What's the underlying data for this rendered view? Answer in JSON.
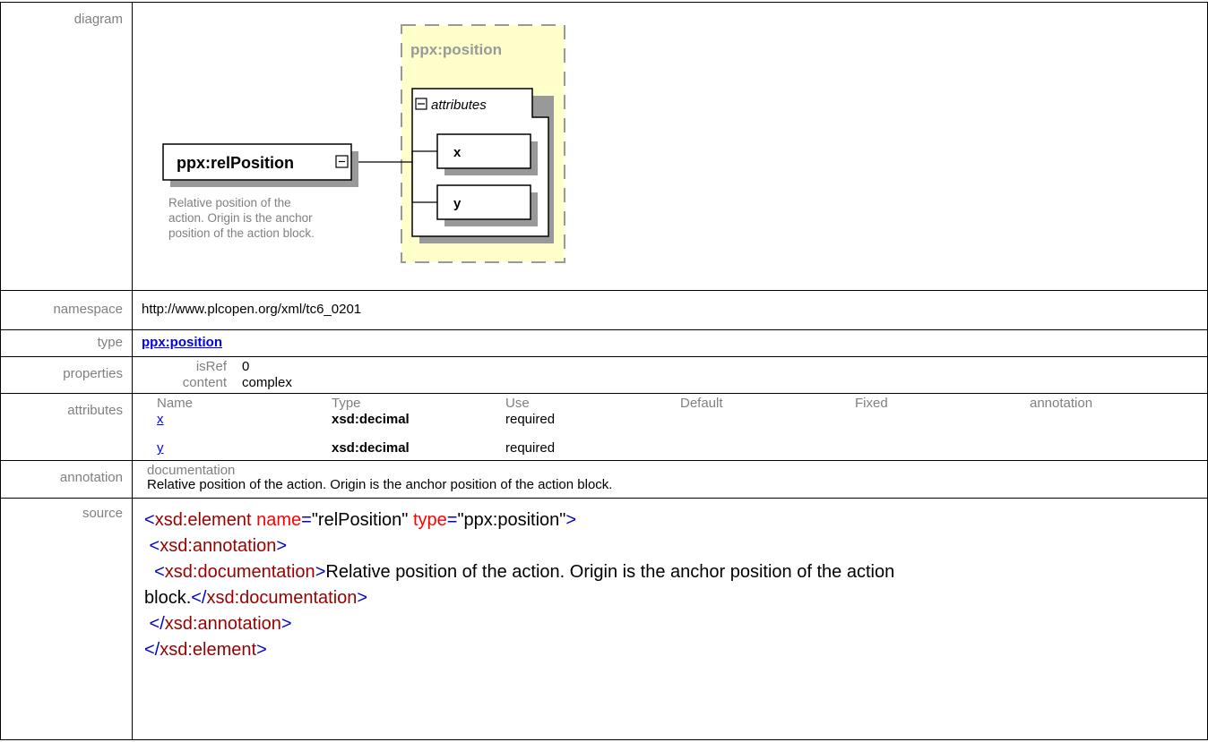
{
  "labels": {
    "diagram": "diagram",
    "namespace": "namespace",
    "type": "type",
    "properties": "properties",
    "attributes": "attributes",
    "annotation": "annotation",
    "source": "source"
  },
  "diagram": {
    "element_name": "ppx:relPosition",
    "element_doc": [
      "Relative position of the",
      "action. Origin is the anchor",
      "position of the action block."
    ],
    "type_name": "ppx:position",
    "attributes_group": "attributes",
    "attr_boxes": [
      "x",
      "y"
    ],
    "colors": {
      "type_fill": "#ffffcc",
      "dash": "#999999",
      "shadow": "#999999"
    }
  },
  "namespace": "http://www.plcopen.org/xml/tc6_0201",
  "type": "ppx:position",
  "properties": [
    {
      "key": "isRef",
      "value": "0"
    },
    {
      "key": "content",
      "value": "complex"
    }
  ],
  "attributes": {
    "headers": [
      "Name",
      "Type",
      "Use",
      "Default",
      "Fixed",
      "annotation"
    ],
    "rows": [
      {
        "name": "x",
        "type": "xsd:decimal",
        "use": "required"
      },
      {
        "name": "y",
        "type": "xsd:decimal",
        "use": "required"
      }
    ]
  },
  "annotation": {
    "key": "documentation",
    "text": "Relative position of the action. Origin is the anchor position of the action block."
  },
  "source": {
    "l1": {
      "open": "<",
      "el": "xsd:element",
      "a1": " name",
      "eq1": "=",
      "v1": "\"relPosition\"",
      "a2": " type",
      "eq2": "=",
      "v2": "\"ppx:position\"",
      "close": ">"
    },
    "l2": {
      "open": " <",
      "el": "xsd:annotation",
      "close": ">"
    },
    "l3": {
      "open": "  <",
      "el": "xsd:documentation",
      "close": ">",
      "text1": "Relative position of the action. Origin is the anchor position of the action"
    },
    "l4": {
      "text": "block.",
      "open": "</",
      "el": "xsd:documentation",
      "close": ">"
    },
    "l5": {
      "open": " </",
      "el": "xsd:annotation",
      "close": ">"
    },
    "l6": {
      "open": "</",
      "el": "xsd:element",
      "close": ">"
    }
  }
}
